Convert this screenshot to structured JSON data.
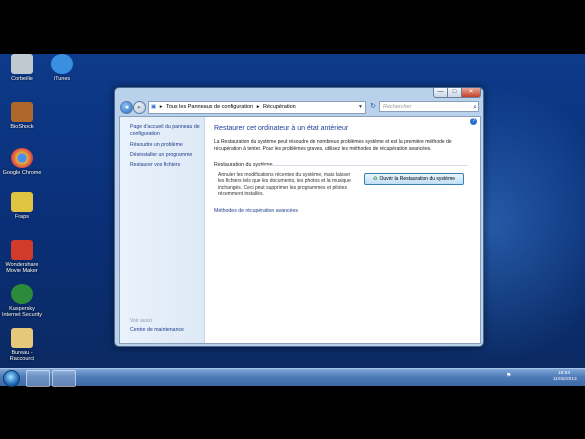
{
  "desktop": {
    "icons": [
      {
        "label": "Corbeille",
        "color": "#c0c8d0"
      },
      {
        "label": "iTunes",
        "color": "#3b8fe0"
      },
      {
        "label": "BioShock",
        "color": "#b0682a"
      },
      {
        "label": "Google Chrome",
        "color": "#e2b53a"
      },
      {
        "label": "Fraps",
        "color": "#e0c341"
      },
      {
        "label": "Wondershare Movie Maker",
        "color": "#d23a2a"
      },
      {
        "label": "Kaspersky Internet Security",
        "color": "#2d8a3a"
      },
      {
        "label": "Bureau - Raccourci",
        "color": "#e6c87a"
      }
    ]
  },
  "window": {
    "caption_buttons": {
      "minimize": "—",
      "maximize": "□",
      "close": "✕"
    },
    "address": {
      "segments": [
        "Tous les Panneaux de configuration",
        "Récupération"
      ],
      "separator": "▸"
    },
    "search_placeholder": "Rechercher",
    "sidebar": {
      "home_link": "Page d'accueil du panneau de configuration",
      "links": [
        "Résoudre un problème",
        "Désinstaller un programme",
        "Restaurer vos fichiers"
      ],
      "see_also": "Voir aussi",
      "maintenance_link": "Centre de maintenance"
    },
    "main": {
      "title": "Restaurer cet ordinateur à un état antérieur",
      "description": "La Restauration du système peut résoudre de nombreux problèmes système et est la première méthode de récupération à tenter. Pour les problèmes graves, utilisez les méthodes de récupération avancées.",
      "section_title": "Restauration du système",
      "section_text": "Annuler les modifications récentes du système, mais laisser les fichiers tels que les documents, les photos et la musique inchangés. Ceci peut supprimer les programmes et pilotes récemment installés.",
      "open_button": "Ouvrir la Restauration du système",
      "advanced_link": "Méthodes de récupération avancées"
    }
  },
  "taskbar": {
    "clock_time": "18:53",
    "clock_date": "11/05/2013"
  }
}
